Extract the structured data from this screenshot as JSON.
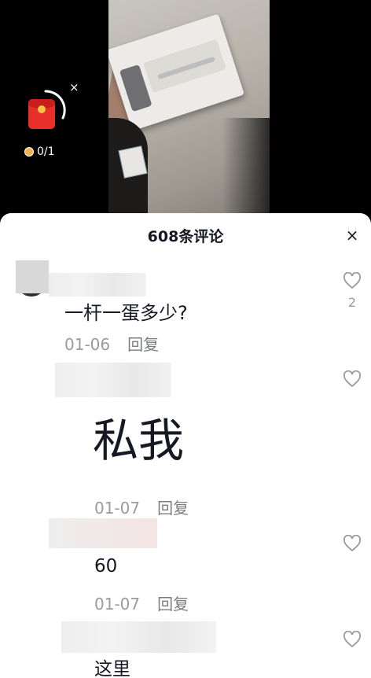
{
  "red_packet": {
    "progress": "0/1",
    "close_symbol": "×"
  },
  "comments_panel": {
    "title": "608条评论",
    "close_symbol": "×",
    "comments": [
      {
        "text": "一杆一蛋多少?",
        "date": "01-06",
        "reply": "回复",
        "likes": "2"
      },
      {
        "text": "私我",
        "date": "01-07",
        "reply": "回复",
        "likes": ""
      },
      {
        "text": "60",
        "date": "01-07",
        "reply": "回复",
        "likes": ""
      },
      {
        "text": "这里",
        "date": "",
        "reply": "",
        "likes": ""
      }
    ]
  },
  "colors": {
    "sheet_background": "#ffffff",
    "red_packet": "#e7302a",
    "meta_text": "#9a9ba0"
  },
  "icons": [
    "red-packet-icon",
    "close-icon",
    "heart-icon"
  ]
}
